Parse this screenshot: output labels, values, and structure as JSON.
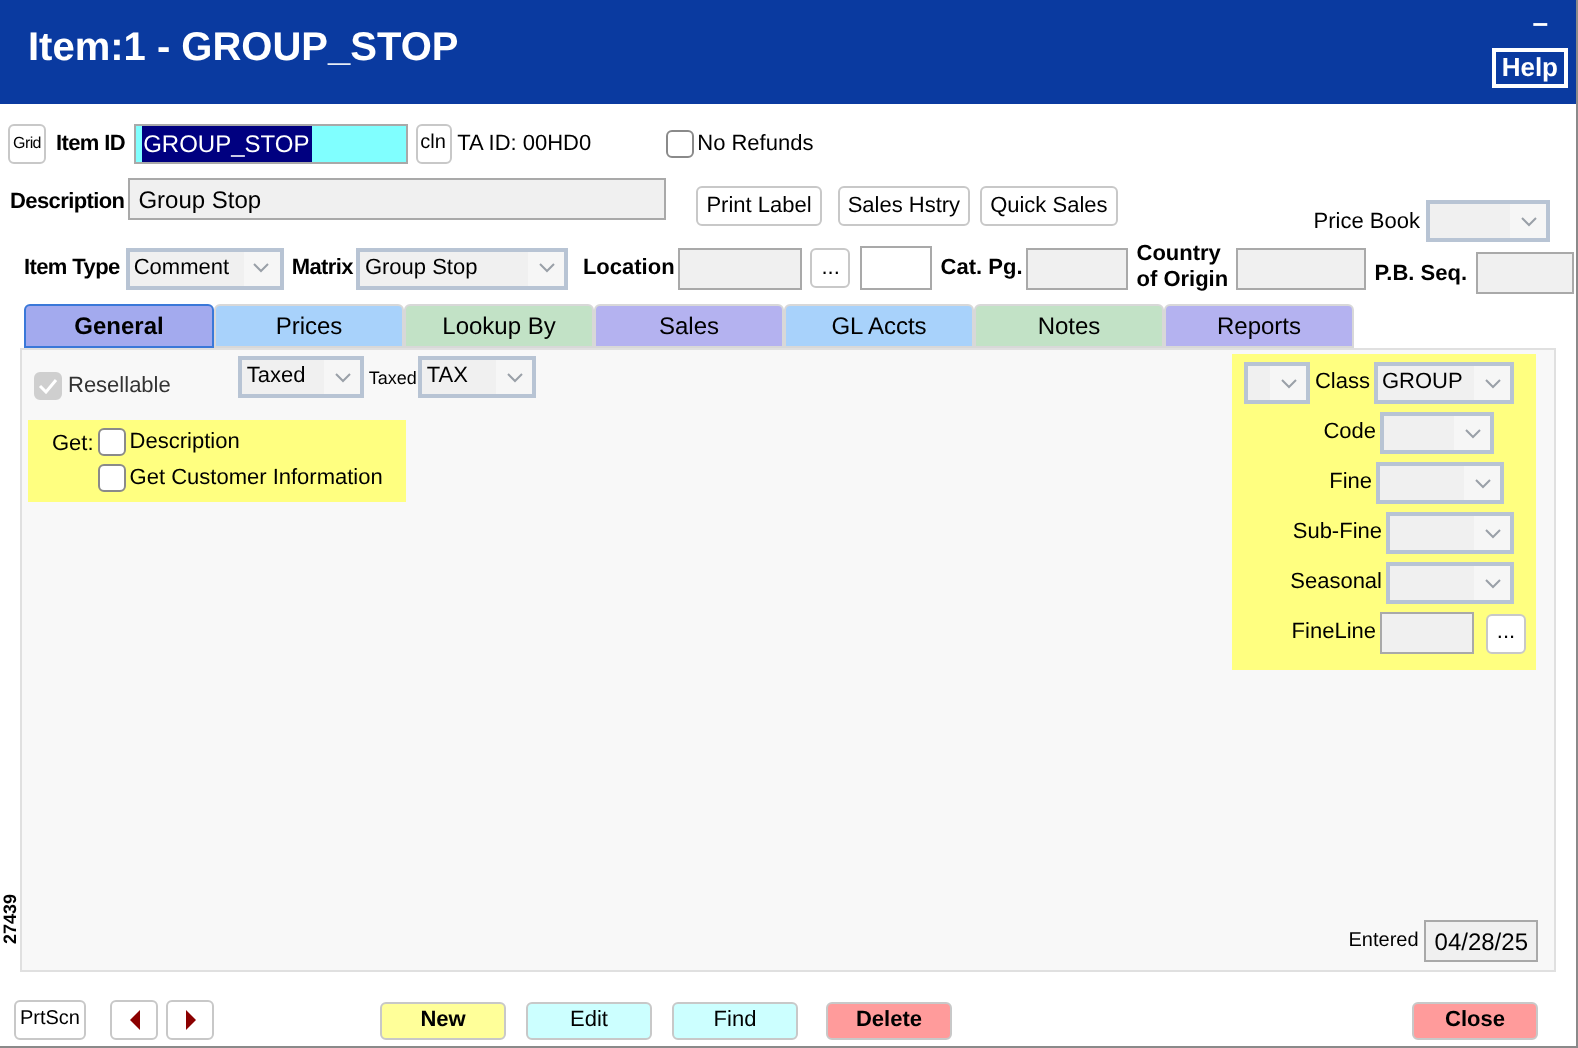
{
  "window": {
    "title": "Item:1 - GROUP_STOP",
    "minimize": "–",
    "help_button": "Help"
  },
  "header": {
    "grid_button": "Grid",
    "item_id": {
      "label": "Item ID",
      "value": "GROUP_STOP",
      "selected": true
    },
    "cln_button": "cln",
    "ta_id": "TA ID: 00HD0",
    "no_refunds": {
      "label": "No Refunds",
      "checked": false
    },
    "description": {
      "label": "Description",
      "value": "Group Stop"
    },
    "buttons": [
      "Print Label",
      "Sales Hstry",
      "Quick Sales"
    ],
    "price_book": {
      "label": "Price Book"
    },
    "item_type": {
      "label": "Item Type",
      "value": "Comment"
    },
    "matrix": {
      "label": "Matrix",
      "value": "Group Stop"
    },
    "location": {
      "label": "Location",
      "browse_button": "..."
    },
    "cat_pg": {
      "label": "Cat. Pg."
    },
    "country_of_origin": {
      "label": "Country of Origin"
    },
    "pb_seq": {
      "label": "P.B. Seq."
    }
  },
  "tabs": [
    {
      "label": "General",
      "color": "#a3aaee",
      "selected": true
    },
    {
      "label": "Prices",
      "color": "#a8d2fb",
      "selected": false
    },
    {
      "label": "Lookup By",
      "color": "#c2e2c6",
      "selected": false
    },
    {
      "label": "Sales",
      "color": "#b4b2f0",
      "selected": false
    },
    {
      "label": "GL Accts",
      "color": "#a8d2fb",
      "selected": false
    },
    {
      "label": "Notes",
      "color": "#c2e2c6",
      "selected": false
    },
    {
      "label": "Reports",
      "color": "#b4b2f0",
      "selected": false
    }
  ],
  "general": {
    "resellable": {
      "label": "Resellable",
      "checked": true,
      "disabled": true
    },
    "tax_status": {
      "value": "Taxed"
    },
    "tax_code": {
      "label": "Taxed",
      "value": "TAX"
    },
    "get": {
      "label": "Get:",
      "options": [
        {
          "label": "Description",
          "checked": false
        },
        {
          "label": "Get Customer Information",
          "checked": false
        }
      ]
    },
    "classification": [
      {
        "kind": "dropdown",
        "label": "Class",
        "value": "GROUP",
        "prefix_dropdown": true
      },
      {
        "kind": "dropdown",
        "label": "Code"
      },
      {
        "kind": "dropdown",
        "label": "Fine"
      },
      {
        "kind": "dropdown",
        "label": "Sub-Fine"
      },
      {
        "kind": "dropdown",
        "label": "Seasonal"
      },
      {
        "kind": "browse",
        "label": "FineLine",
        "button": "..."
      }
    ],
    "entered": {
      "label": "Entered",
      "value": "04/28/25"
    }
  },
  "record_number": "27439",
  "footer": {
    "prtscn_button": "PrtScn",
    "actions": [
      {
        "label": "New",
        "color": "#ffff99"
      },
      {
        "label": "Edit",
        "color": "#ccffff"
      },
      {
        "label": "Find",
        "color": "#ccffff"
      },
      {
        "label": "Delete",
        "color": "#ff9b9b"
      }
    ],
    "close_button": {
      "label": "Close",
      "color": "#ff9b9b"
    }
  }
}
